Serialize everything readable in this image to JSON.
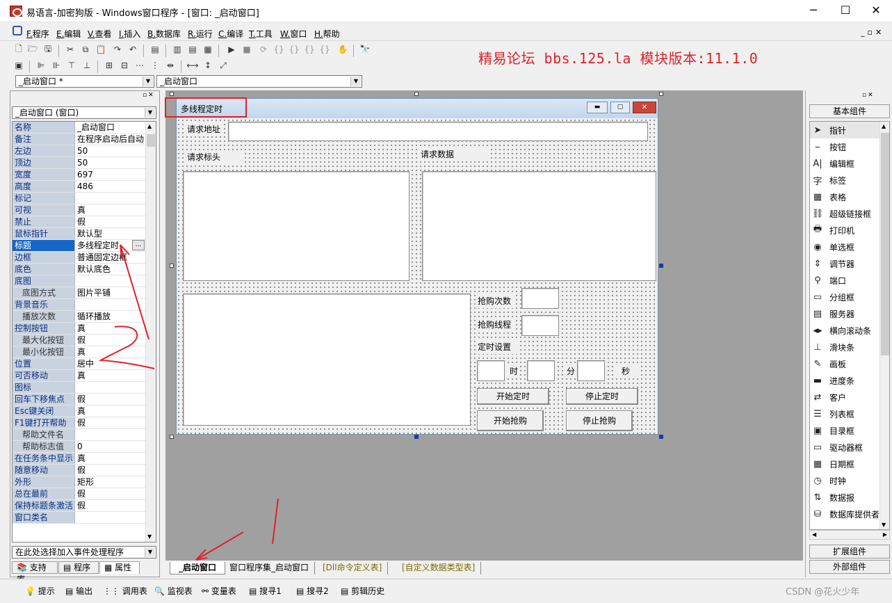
{
  "window": {
    "title": "易语言-加密狗版 - Windows窗口程序 - [窗口: _启动窗口]",
    "minimize": "─",
    "maximize": "☐",
    "close": "✕"
  },
  "menu": [
    {
      "key": "F.",
      "label": "程序"
    },
    {
      "key": "E.",
      "label": "编辑"
    },
    {
      "key": "V.",
      "label": "查看"
    },
    {
      "key": "I.",
      "label": "插入"
    },
    {
      "key": "B.",
      "label": "数据库"
    },
    {
      "key": "R.",
      "label": "运行"
    },
    {
      "key": "C.",
      "label": "编译"
    },
    {
      "key": "T.",
      "label": "工具"
    },
    {
      "key": "W.",
      "label": "窗口"
    },
    {
      "key": "H.",
      "label": "帮助"
    }
  ],
  "banner": "精易论坛 bbs.125.la 模块版本:11.1.0",
  "selectors": {
    "object": "_启动窗口 *",
    "event": "_启动窗口"
  },
  "left_panel": {
    "object_combo": "_启动窗口 (窗口)",
    "properties": [
      {
        "name": "名称",
        "value": "_启动窗口"
      },
      {
        "name": "备注",
        "value": "在程序启动后自动"
      },
      {
        "name": "左边",
        "value": "50"
      },
      {
        "name": "顶边",
        "value": "50"
      },
      {
        "name": "宽度",
        "value": "697"
      },
      {
        "name": "高度",
        "value": "486"
      },
      {
        "name": "标记",
        "value": ""
      },
      {
        "name": "可视",
        "value": "真"
      },
      {
        "name": "禁止",
        "value": "假"
      },
      {
        "name": "鼠标指针",
        "value": "默认型"
      },
      {
        "name": "标题",
        "value": "多线程定时"
      },
      {
        "name": "边框",
        "value": "普通固定边框"
      },
      {
        "name": "底色",
        "value": "默认底色"
      },
      {
        "name": "底图",
        "value": ""
      },
      {
        "name": "底图方式",
        "value": "图片平铺",
        "sub": true
      },
      {
        "name": "背景音乐",
        "value": ""
      },
      {
        "name": "播放次数",
        "value": "循环播放",
        "sub": true
      },
      {
        "name": "控制按钮",
        "value": "真"
      },
      {
        "name": "最大化按钮",
        "value": "假",
        "sub": true
      },
      {
        "name": "最小化按钮",
        "value": "真",
        "sub": true
      },
      {
        "name": "位置",
        "value": "居中"
      },
      {
        "name": "可否移动",
        "value": "真"
      },
      {
        "name": "图标",
        "value": ""
      },
      {
        "name": "回车下移焦点",
        "value": "假"
      },
      {
        "name": "Esc键关闭",
        "value": "真"
      },
      {
        "name": "F1键打开帮助",
        "value": "假"
      },
      {
        "name": "帮助文件名",
        "value": "",
        "sub": true
      },
      {
        "name": "帮助标志值",
        "value": "0",
        "sub": true
      },
      {
        "name": "在任务条中显示",
        "value": "真"
      },
      {
        "name": "随意移动",
        "value": "假"
      },
      {
        "name": "外形",
        "value": "矩形"
      },
      {
        "name": "总在最前",
        "value": "假"
      },
      {
        "name": "保持标题条激活",
        "value": "假"
      },
      {
        "name": "窗口类名",
        "value": ""
      }
    ],
    "event_combo": "在此处选择加入事件处理程序",
    "tabs": [
      "支持库",
      "程序",
      "属性"
    ],
    "selected_property_button": "..."
  },
  "form": {
    "title": "多线程定时",
    "request_url_label": "请求地址",
    "request_header_label": "请求标头",
    "request_data_label": "请求数据",
    "buy_count_label": "抢购次数",
    "buy_threads_label": "抢购线程",
    "timer_label": "定时设置",
    "hour": "时",
    "minute": "分",
    "second": "秒",
    "start_timer": "开始定时",
    "stop_timer": "停止定时",
    "start_buy": "开始抢购",
    "stop_buy": "停止抢购"
  },
  "editor_tabs": [
    "_启动窗口",
    "窗口程序集_启动窗口",
    "[Dll命令定义表]",
    "[自定义数据类型表]"
  ],
  "right_panel": {
    "header": "基本组件",
    "components": [
      {
        "icon": "pointer-icon",
        "glyph": "➤",
        "label": "指针"
      },
      {
        "icon": "button-icon",
        "glyph": "⎯",
        "label": "按钮"
      },
      {
        "icon": "editbox-icon",
        "glyph": "A|",
        "label": "编辑框"
      },
      {
        "icon": "label-icon",
        "glyph": "字",
        "label": "标签"
      },
      {
        "icon": "table-icon",
        "glyph": "▦",
        "label": "表格"
      },
      {
        "icon": "hyperlink-icon",
        "glyph": "⛓",
        "label": "超级链接框"
      },
      {
        "icon": "printer-icon",
        "glyph": "🖶",
        "label": "打印机"
      },
      {
        "icon": "radio-icon",
        "glyph": "◉",
        "label": "单选框"
      },
      {
        "icon": "adjuster-icon",
        "glyph": "⇕",
        "label": "调节器"
      },
      {
        "icon": "port-icon",
        "glyph": "⚲",
        "label": "端口"
      },
      {
        "icon": "groupbox-icon",
        "glyph": "▭",
        "label": "分组框"
      },
      {
        "icon": "server-icon",
        "glyph": "▤",
        "label": "服务器"
      },
      {
        "icon": "hscroll-icon",
        "glyph": "◂▸",
        "label": "横向滚动条"
      },
      {
        "icon": "slider-icon",
        "glyph": "⊥",
        "label": "滑块条"
      },
      {
        "icon": "canvas-icon",
        "glyph": "✎",
        "label": "画板"
      },
      {
        "icon": "progress-icon",
        "glyph": "▬",
        "label": "进度条"
      },
      {
        "icon": "client-icon",
        "glyph": "⇄",
        "label": "客户"
      },
      {
        "icon": "listbox-icon",
        "glyph": "☰",
        "label": "列表框"
      },
      {
        "icon": "dirbox-icon",
        "glyph": "▣",
        "label": "目录框"
      },
      {
        "icon": "drivebox-icon",
        "glyph": "▭",
        "label": "驱动器框"
      },
      {
        "icon": "calendar-icon",
        "glyph": "▦",
        "label": "日期框"
      },
      {
        "icon": "clock-icon",
        "glyph": "◷",
        "label": "时钟"
      },
      {
        "icon": "datareport-icon",
        "glyph": "⇅",
        "label": "数据报"
      },
      {
        "icon": "dbprovider-icon",
        "glyph": "⛁",
        "label": "数据库提供者"
      }
    ],
    "expand_components": "扩展组件",
    "external_components": "外部组件"
  },
  "status_tabs": [
    "提示",
    "输出",
    "调用表",
    "监视表",
    "变量表",
    "搜寻1",
    "搜寻2",
    "剪辑历史"
  ],
  "watermark": "CSDN @花火少年"
}
